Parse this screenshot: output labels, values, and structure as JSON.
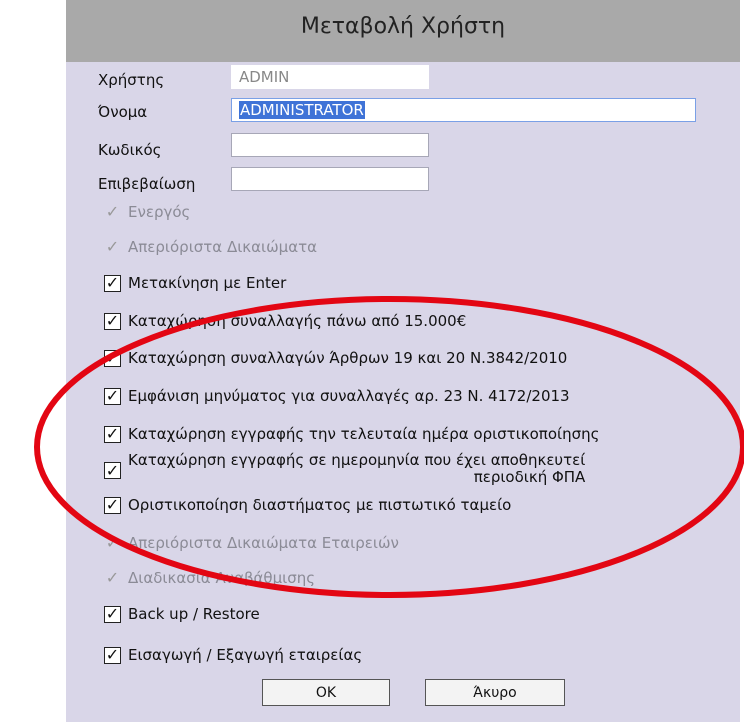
{
  "dialog": {
    "title": "Μεταβολή Χρήστη"
  },
  "fields": {
    "user_label": "Χρήστης",
    "user_value": "ADMIN",
    "name_label": "Όνομα",
    "name_value": "ADMINISTRATOR",
    "password_label": "Κωδικός",
    "password_value": "",
    "confirm_label": "Επιβεβαίωση",
    "confirm_value": ""
  },
  "checkboxes": {
    "active": "Ενεργός",
    "unlimited_rights": "Απεριόριστα Δικαιώματα",
    "enter_navigation": "Μετακίνηση με Enter",
    "transactions_over_15000": "Καταχώρηση συναλλαγής πάνω από 15.000€",
    "articles_19_20": "Καταχώρηση συναλλαγών Άρθρων 19 και 20 Ν.3842/2010",
    "message_article_23": "Εμφάνιση μηνύματος για συναλλαγές αρ. 23 Ν. 4172/2013",
    "last_day_finalization": "Καταχώρηση εγγραφής την τελευταία ημέρα οριστικοποίησης",
    "saved_vat_period_line1": "Καταχώρηση εγγραφής σε ημερομηνία που έχει αποθηκευτεί",
    "saved_vat_period_line2": "περιοδική ΦΠΑ",
    "credit_cash_finalization": "Οριστικοποίηση διαστήματος με πιστωτικό ταμείο",
    "unlimited_company_rights": "Απεριόριστα Δικαιώματα Εταιρειών",
    "upgrade_procedure": "Διαδικασία Αναβάθμισης",
    "backup_restore": "Back up / Restore",
    "import_export_company": "Εισαγωγή / Εξαγωγή εταιρείας"
  },
  "buttons": {
    "ok": "OK",
    "cancel": "Άκυρο"
  },
  "colors": {
    "annotation": "#e30613",
    "dialog_bg": "#d9d6e8",
    "titlebar": "#a9a9a9"
  }
}
